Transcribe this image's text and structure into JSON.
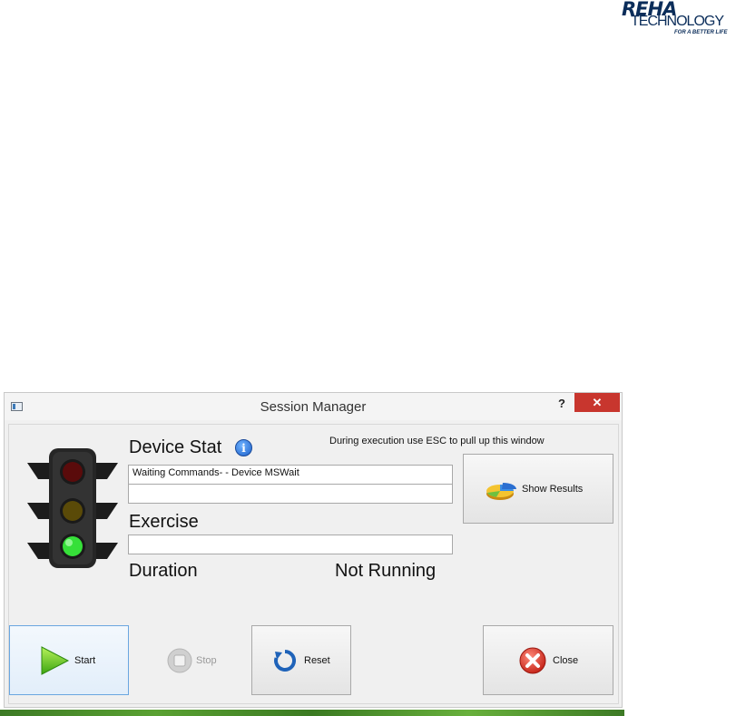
{
  "logo": {
    "line1": "REHA",
    "line2": "TECHNOLOGY",
    "tagline": "FOR A BETTER LIFE"
  },
  "window": {
    "title": "Session Manager",
    "help_label": "?",
    "close_label": "✕"
  },
  "panel": {
    "device_status_label": "Device Stat",
    "hint": "During execution use ESC to pull up this window",
    "status_line1": "Waiting Commands- - Device MSWait",
    "status_line2": "",
    "exercise_label": "Exercise",
    "exercise_value": "",
    "duration_label": "Duration",
    "duration_value": "Not Running",
    "traffic_light_state": "green"
  },
  "buttons": {
    "show_results": "Show Results",
    "start": "Start",
    "stop": "Stop",
    "reset": "Reset",
    "close": "Close"
  },
  "colors": {
    "titlebar_close": "#c8362e",
    "accent_blue": "#1b5fc9",
    "go_green": "#36e039"
  }
}
